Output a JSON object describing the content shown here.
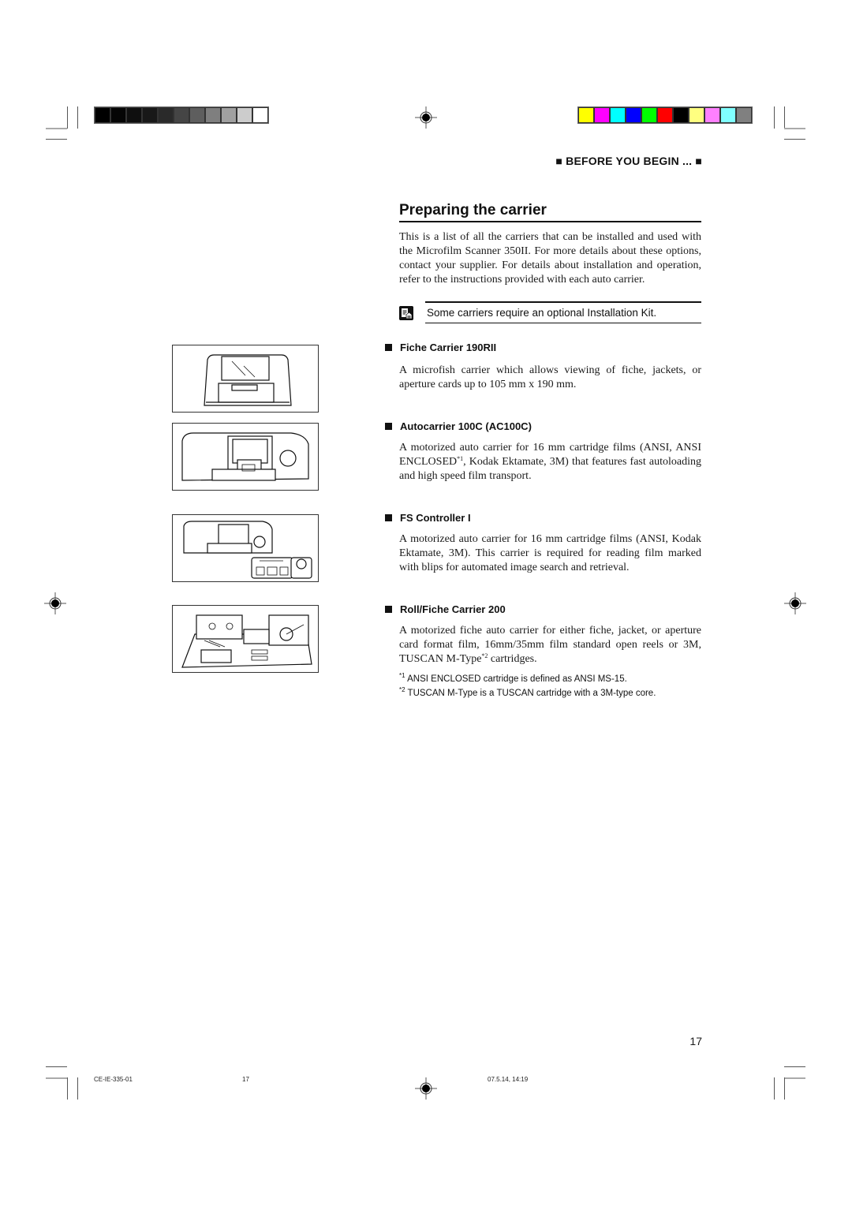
{
  "header": {
    "section_tag": "■ BEFORE YOU BEGIN ... ■",
    "grayscale_bar": [
      "#000000",
      "#050505",
      "#0f0f0f",
      "#181818",
      "#2a2a2a",
      "#454545",
      "#5e5e5e",
      "#7f7f7f",
      "#a0a0a0",
      "#cccccc",
      "#ffffff"
    ],
    "color_bar": [
      "#ffff00",
      "#ff00ff",
      "#00ffff",
      "#0000ff",
      "#00ff00",
      "#ff0000",
      "#000000",
      "#ffff80",
      "#ff80ff",
      "#80ffff",
      "#808080"
    ]
  },
  "page": {
    "title": "Preparing the carrier",
    "intro": "This is a list of all the carriers that can be installed and used with the Microfilm Scanner 350II. For more details about these options, contact your supplier. For details about installation and operation, refer to the instructions provided with each auto carrier.",
    "note": {
      "icon": "memo-icon",
      "text": "Some carriers require an optional Installation Kit."
    },
    "carriers": [
      {
        "name": "Fiche Carrier 190RII",
        "description": "A microfish carrier which allows viewing of fiche, jackets, or aperture cards up to 105 mm x 190 mm.",
        "illustration": "fiche-carrier-illustration"
      },
      {
        "name": "Autocarrier 100C (AC100C)",
        "description_parts": [
          "A motorized auto carrier for 16 mm cartridge films (ANSI, ANSI ENCLOSED",
          "*1",
          ", Kodak Ektamate, 3M) that features fast autoloading and high speed film transport."
        ],
        "illustration": "autocarrier-illustration"
      },
      {
        "name": "FS Controller I",
        "description": "A motorized auto carrier for 16 mm cartridge films (ANSI, Kodak Ektamate, 3M). This carrier is required for reading film marked with blips for automated image search and retrieval.",
        "illustration": "fs-controller-illustration"
      },
      {
        "name": "Roll/Fiche Carrier 200",
        "description_parts": [
          "A motorized fiche auto carrier for either fiche, jacket, or aperture card format film, 16mm/35mm film standard open reels or 3M, TUSCAN M-Type",
          "*2",
          " cartridges."
        ],
        "illustration": "roll-fiche-carrier-illustration"
      }
    ],
    "footnotes": [
      {
        "mark": "*1",
        "text": " ANSI ENCLOSED cartridge is defined as ANSI MS-15."
      },
      {
        "mark": "*2",
        "text": " TUSCAN M-Type is a TUSCAN cartridge with a 3M-type core."
      }
    ],
    "page_number": "17"
  },
  "footer": {
    "doc_code": "CE-IE-335-01",
    "page": "17",
    "timestamp": "07.5.14, 14:19"
  }
}
